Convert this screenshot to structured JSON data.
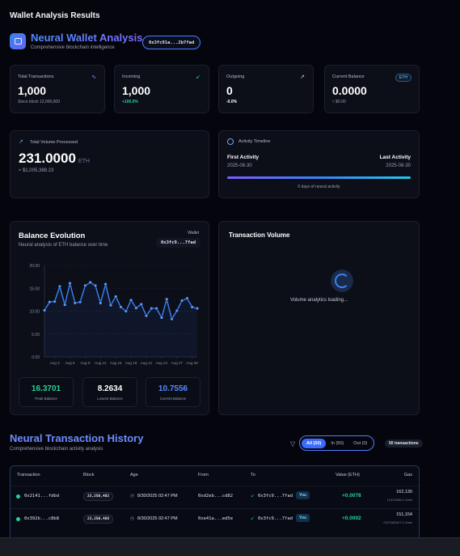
{
  "page_title": "Wallet Analysis Results",
  "header": {
    "brand": "Neural Wallet Analysis",
    "subtitle": "Comprehensive blockchain intelligence",
    "address": "0x3fc91a...2b7fad"
  },
  "stats": [
    {
      "label": "Total Transactions",
      "value": "1,000",
      "sub": "Since block 12,000,000",
      "icon": "activity-icon"
    },
    {
      "label": "Incoming",
      "value": "1,000",
      "sub": "+100.0%",
      "icon": "arrow-down-left-icon"
    },
    {
      "label": "Outgoing",
      "value": "0",
      "sub": "-0.0%",
      "icon": "arrow-up-right-icon"
    },
    {
      "label": "Current Balance",
      "value": "0.0000",
      "sub": "≈ $0.00",
      "badge": "ETH"
    }
  ],
  "volume": {
    "label": "Total Volume Processed",
    "value": "231.0000",
    "unit": "ETH",
    "usd": "≈ $1,005,388.23"
  },
  "activity": {
    "label": "Activity Timeline",
    "first_label": "First Activity",
    "first_date": "2025-08-30",
    "last_label": "Last Activity",
    "last_date": "2025-08-30",
    "days": "0 days of neural activity"
  },
  "balance_evolution": {
    "title": "Balance Evolution",
    "subtitle": "Neural analysis of ETH balance over time",
    "wallet_label": "Wallet",
    "wallet": "0x3fc9...7fad",
    "peak": "16.3701",
    "peak_label": "Peak Balance",
    "lowest": "8.2634",
    "lowest_label": "Lowest Balance",
    "current": "10.7556",
    "current_label": "Current Balance"
  },
  "chart_data": {
    "type": "line",
    "title": "",
    "xlabel": "",
    "ylabel": "",
    "ylim": [
      0,
      20
    ],
    "yticks": [
      "0.00",
      "5.00",
      "10.00",
      "15.00",
      "20.00"
    ],
    "x_tick_labels": [
      "Aug 3",
      "Aug 6",
      "Aug 9",
      "Aug 12",
      "Aug 15",
      "Aug 18",
      "Aug 21",
      "Aug 24",
      "Aug 27",
      "Aug 30"
    ],
    "x": [
      1,
      2,
      3,
      4,
      5,
      6,
      7,
      8,
      9,
      10,
      11,
      12,
      13,
      14,
      15,
      16,
      17,
      18,
      19,
      20,
      21,
      22,
      23,
      24,
      25,
      26,
      27,
      28,
      29,
      30,
      31
    ],
    "values": [
      10.2,
      12.0,
      12.1,
      15.4,
      11.4,
      16.1,
      11.8,
      12.0,
      15.6,
      16.3,
      15.6,
      11.8,
      15.9,
      11.3,
      13.2,
      10.9,
      10.0,
      12.4,
      10.7,
      11.5,
      9.0,
      10.6,
      10.6,
      8.6,
      12.6,
      8.3,
      10.1,
      12.3,
      12.8,
      10.9,
      10.6
    ],
    "grid": true,
    "legend": "none"
  },
  "volume_chart": {
    "title": "Transaction Volume",
    "loading": "Volume analytics loading..."
  },
  "history": {
    "title": "Neural Transaction History",
    "subtitle": "Comprehensive blockchain activity analysis",
    "filters": [
      "All (50)",
      "In (50)",
      "Out (0)"
    ],
    "count": "50 transactions",
    "columns": [
      "Transaction",
      "Block",
      "Age",
      "From",
      "To",
      "Value (ETH)",
      "Gas"
    ],
    "rows": [
      {
        "tx": "0x2141...fdbd",
        "block": "23,250,482",
        "age": "8/30/2025 02:47 PM",
        "from": "0xd2eb...cd82",
        "to": "0x3fc9...7fad",
        "you": "You",
        "value": "+0.0078",
        "gas": "162,130",
        "gas_sub": "12313056.0 Gwei"
      },
      {
        "tx": "0x392b...c8b8",
        "block": "23,250,468",
        "age": "8/30/2025 02:47 PM",
        "from": "0xe41a...ed5e",
        "to": "0x3fc9...7fad",
        "you": "You",
        "value": "+0.0002",
        "gas": "151,154",
        "gas_sub": "2327086327.0 Gwei"
      }
    ]
  },
  "colors": {
    "accent": "#3b6cff",
    "positive": "#22d39a",
    "line": "#3b82f6",
    "background": "#05060d"
  }
}
